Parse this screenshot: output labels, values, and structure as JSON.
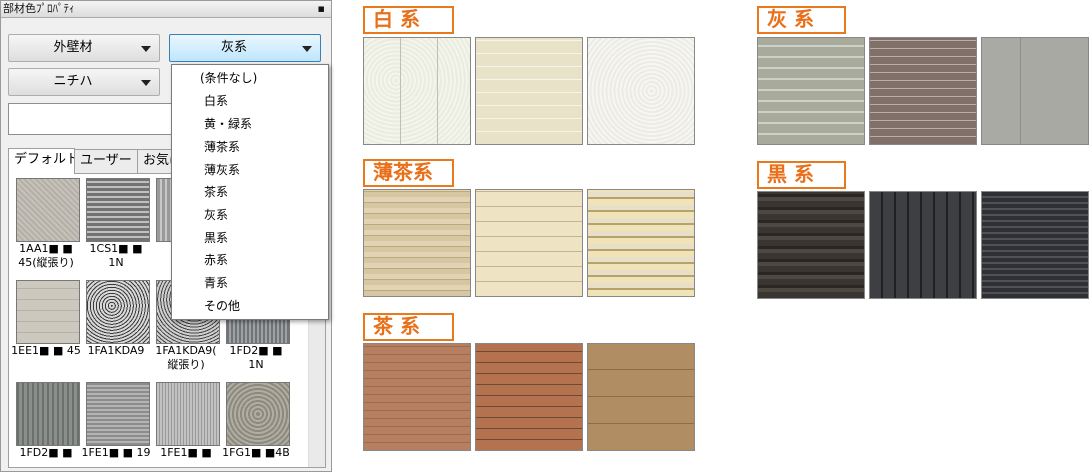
{
  "panel": {
    "title": "部材色ﾌﾟﾛﾊﾟﾃｨ",
    "pin_icon": "pin-icon",
    "combo_type": "外壁材",
    "combo_color": "灰系",
    "combo_maker": "ニチハ",
    "search_value": "",
    "tabs": [
      {
        "label": "デフォルト"
      },
      {
        "label": "ユーザー"
      },
      {
        "label": "お気に"
      }
    ],
    "materials": [
      {
        "code": "1AA1■ ■",
        "sub": "45(縦張り)"
      },
      {
        "code": "1CS1■ ■",
        "sub": "1N"
      },
      {
        "code": "1",
        "sub": "1"
      },
      {
        "code": "1EE1■ ■ 45",
        "sub": ""
      },
      {
        "code": "1FA1KDA9",
        "sub": ""
      },
      {
        "code": "1FA1KDA9(",
        "sub": "縦張り)"
      },
      {
        "code": "1FD2■ ■",
        "sub": "1N"
      },
      {
        "code": "1FD2■ ■",
        "sub": ""
      },
      {
        "code": "1FE1■ ■ 19",
        "sub": ""
      },
      {
        "code": "1FE1■ ■",
        "sub": ""
      },
      {
        "code": "1FG1■ ■4B",
        "sub": ""
      }
    ]
  },
  "dropdown": {
    "options": [
      "(条件なし)",
      "白系",
      "黄・緑系",
      "薄茶系",
      "薄灰系",
      "茶系",
      "灰系",
      "黒系",
      "赤系",
      "青系",
      "その他"
    ]
  },
  "legend": {
    "white": "白  系",
    "gray": "灰  系",
    "beige": "薄茶系",
    "black": "黒  系",
    "brown": "茶  系"
  },
  "colors": {
    "accent_orange": "#e8791c",
    "combo_active": "#bee6fd"
  }
}
